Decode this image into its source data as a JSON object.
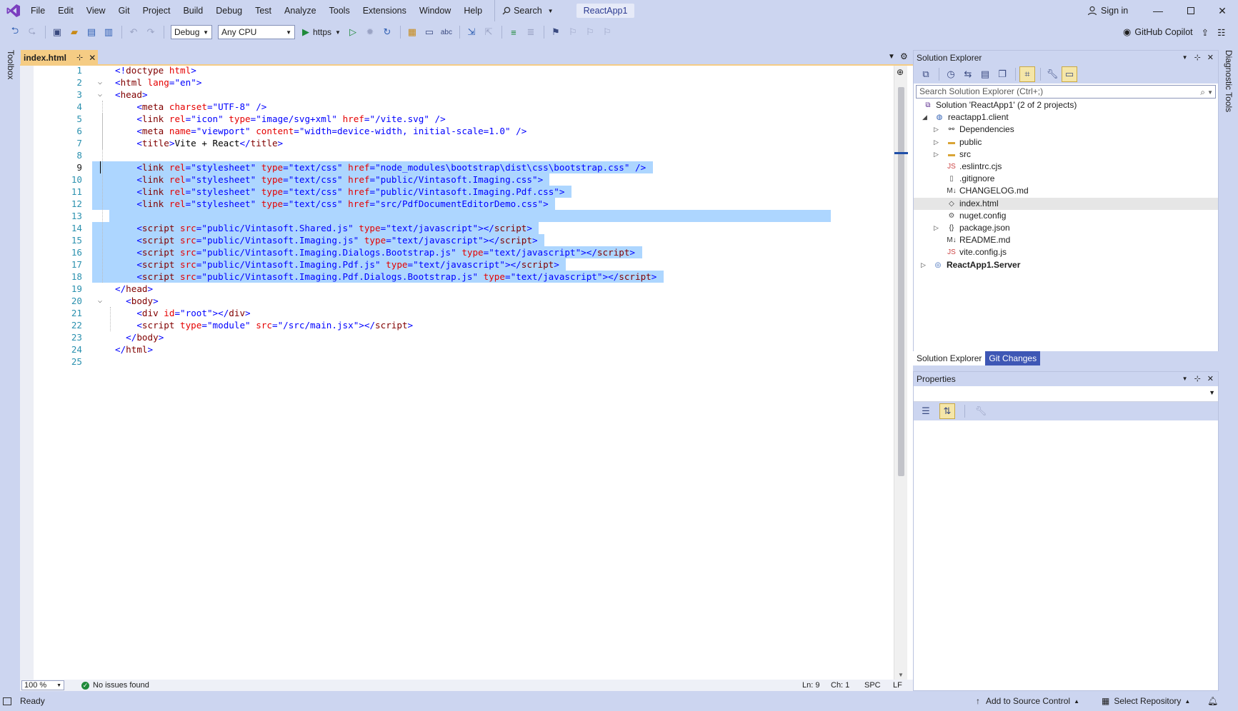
{
  "menubar": {
    "items": [
      "File",
      "Edit",
      "View",
      "Git",
      "Project",
      "Build",
      "Debug",
      "Test",
      "Analyze",
      "Tools",
      "Extensions",
      "Window",
      "Help"
    ],
    "search_label": "Search",
    "solution_name": "ReactApp1",
    "sign_in": "Sign in"
  },
  "toolbar": {
    "configuration": "Debug",
    "platform": "Any CPU",
    "run_target": "https",
    "copilot": "GitHub Copilot"
  },
  "side": {
    "toolbox": "Toolbox",
    "diagnostic_tools": "Diagnostic Tools"
  },
  "editor": {
    "tab_name": "index.html",
    "zoom": "100 %",
    "issues": "No issues found",
    "status": {
      "ln": "Ln: 9",
      "ch": "Ch: 1",
      "enc": "SPC",
      "eol": "LF"
    },
    "current_line": 9,
    "lines": [
      [
        [
          "<!",
          "pun"
        ],
        [
          "doctype",
          "tag"
        ],
        [
          " ",
          "txt"
        ],
        [
          "html",
          "attr"
        ],
        [
          ">",
          "pun"
        ]
      ],
      [
        [
          "<",
          "pun"
        ],
        [
          "html",
          "tag"
        ],
        [
          " ",
          "txt"
        ],
        [
          "lang",
          "attr"
        ],
        [
          "=",
          "pun"
        ],
        [
          "\"en\"",
          "val"
        ],
        [
          ">",
          "pun"
        ]
      ],
      [
        [
          "<",
          "pun"
        ],
        [
          "head",
          "tag"
        ],
        [
          ">",
          "pun"
        ]
      ],
      [
        [
          "    <",
          "pun"
        ],
        [
          "meta",
          "tag"
        ],
        [
          " ",
          "txt"
        ],
        [
          "charset",
          "attr"
        ],
        [
          "=",
          "pun"
        ],
        [
          "\"UTF-8\"",
          "val"
        ],
        [
          " />",
          "pun"
        ]
      ],
      [
        [
          "    <",
          "pun"
        ],
        [
          "link",
          "tag"
        ],
        [
          " ",
          "txt"
        ],
        [
          "rel",
          "attr"
        ],
        [
          "=",
          "pun"
        ],
        [
          "\"icon\"",
          "val"
        ],
        [
          " ",
          "txt"
        ],
        [
          "type",
          "attr"
        ],
        [
          "=",
          "pun"
        ],
        [
          "\"image/svg+xml\"",
          "val"
        ],
        [
          " ",
          "txt"
        ],
        [
          "href",
          "attr"
        ],
        [
          "=",
          "pun"
        ],
        [
          "\"/vite.svg\"",
          "val"
        ],
        [
          " />",
          "pun"
        ]
      ],
      [
        [
          "    <",
          "pun"
        ],
        [
          "meta",
          "tag"
        ],
        [
          " ",
          "txt"
        ],
        [
          "name",
          "attr"
        ],
        [
          "=",
          "pun"
        ],
        [
          "\"viewport\"",
          "val"
        ],
        [
          " ",
          "txt"
        ],
        [
          "content",
          "attr"
        ],
        [
          "=",
          "pun"
        ],
        [
          "\"width=device-width, initial-scale=1.0\"",
          "val"
        ],
        [
          " />",
          "pun"
        ]
      ],
      [
        [
          "    <",
          "pun"
        ],
        [
          "title",
          "tag"
        ],
        [
          ">",
          "pun"
        ],
        [
          "Vite + React",
          "txt"
        ],
        [
          "</",
          "pun"
        ],
        [
          "title",
          "tag"
        ],
        [
          ">",
          "pun"
        ]
      ],
      [],
      [
        [
          "    <",
          "pun"
        ],
        [
          "link",
          "tag"
        ],
        [
          " ",
          "txt"
        ],
        [
          "rel",
          "attr"
        ],
        [
          "=",
          "pun"
        ],
        [
          "\"stylesheet\"",
          "val"
        ],
        [
          " ",
          "txt"
        ],
        [
          "type",
          "attr"
        ],
        [
          "=",
          "pun"
        ],
        [
          "\"text/css\"",
          "val"
        ],
        [
          " ",
          "txt"
        ],
        [
          "href",
          "attr"
        ],
        [
          "=",
          "pun"
        ],
        [
          "\"node_modules\\bootstrap\\dist\\css\\bootstrap.css\"",
          "val"
        ],
        [
          " />",
          "pun"
        ]
      ],
      [
        [
          "    <",
          "pun"
        ],
        [
          "link",
          "tag"
        ],
        [
          " ",
          "txt"
        ],
        [
          "rel",
          "attr"
        ],
        [
          "=",
          "pun"
        ],
        [
          "\"stylesheet\"",
          "val"
        ],
        [
          " ",
          "txt"
        ],
        [
          "type",
          "attr"
        ],
        [
          "=",
          "pun"
        ],
        [
          "\"text/css\"",
          "val"
        ],
        [
          " ",
          "txt"
        ],
        [
          "href",
          "attr"
        ],
        [
          "=",
          "pun"
        ],
        [
          "\"public/Vintasoft.Imaging.css\"",
          "val"
        ],
        [
          ">",
          "pun"
        ]
      ],
      [
        [
          "    <",
          "pun"
        ],
        [
          "link",
          "tag"
        ],
        [
          " ",
          "txt"
        ],
        [
          "rel",
          "attr"
        ],
        [
          "=",
          "pun"
        ],
        [
          "\"stylesheet\"",
          "val"
        ],
        [
          " ",
          "txt"
        ],
        [
          "type",
          "attr"
        ],
        [
          "=",
          "pun"
        ],
        [
          "\"text/css\"",
          "val"
        ],
        [
          " ",
          "txt"
        ],
        [
          "href",
          "attr"
        ],
        [
          "=",
          "pun"
        ],
        [
          "\"public/Vintasoft.Imaging.Pdf.css\"",
          "val"
        ],
        [
          ">",
          "pun"
        ]
      ],
      [
        [
          "    <",
          "pun"
        ],
        [
          "link",
          "tag"
        ],
        [
          " ",
          "txt"
        ],
        [
          "rel",
          "attr"
        ],
        [
          "=",
          "pun"
        ],
        [
          "\"stylesheet\"",
          "val"
        ],
        [
          " ",
          "txt"
        ],
        [
          "type",
          "attr"
        ],
        [
          "=",
          "pun"
        ],
        [
          "\"text/css\"",
          "val"
        ],
        [
          " ",
          "txt"
        ],
        [
          "href",
          "attr"
        ],
        [
          "=",
          "pun"
        ],
        [
          "\"src/PdfDocumentEditorDemo.css\"",
          "val"
        ],
        [
          ">",
          "pun"
        ]
      ],
      [],
      [
        [
          "    <",
          "pun"
        ],
        [
          "script",
          "tag"
        ],
        [
          " ",
          "txt"
        ],
        [
          "src",
          "attr"
        ],
        [
          "=",
          "pun"
        ],
        [
          "\"public/Vintasoft.Shared.js\"",
          "val"
        ],
        [
          " ",
          "txt"
        ],
        [
          "type",
          "attr"
        ],
        [
          "=",
          "pun"
        ],
        [
          "\"text/javascript\"",
          "val"
        ],
        [
          "></",
          "pun"
        ],
        [
          "script",
          "tag"
        ],
        [
          ">",
          "pun"
        ]
      ],
      [
        [
          "    <",
          "pun"
        ],
        [
          "script",
          "tag"
        ],
        [
          " ",
          "txt"
        ],
        [
          "src",
          "attr"
        ],
        [
          "=",
          "pun"
        ],
        [
          "\"public/Vintasoft.Imaging.js\"",
          "val"
        ],
        [
          " ",
          "txt"
        ],
        [
          "type",
          "attr"
        ],
        [
          "=",
          "pun"
        ],
        [
          "\"text/javascript\"",
          "val"
        ],
        [
          "></",
          "pun"
        ],
        [
          "script",
          "tag"
        ],
        [
          ">",
          "pun"
        ]
      ],
      [
        [
          "    <",
          "pun"
        ],
        [
          "script",
          "tag"
        ],
        [
          " ",
          "txt"
        ],
        [
          "src",
          "attr"
        ],
        [
          "=",
          "pun"
        ],
        [
          "\"public/Vintasoft.Imaging.Dialogs.Bootstrap.js\"",
          "val"
        ],
        [
          " ",
          "txt"
        ],
        [
          "type",
          "attr"
        ],
        [
          "=",
          "pun"
        ],
        [
          "\"text/javascript\"",
          "val"
        ],
        [
          "></",
          "pun"
        ],
        [
          "script",
          "tag"
        ],
        [
          ">",
          "pun"
        ]
      ],
      [
        [
          "    <",
          "pun"
        ],
        [
          "script",
          "tag"
        ],
        [
          " ",
          "txt"
        ],
        [
          "src",
          "attr"
        ],
        [
          "=",
          "pun"
        ],
        [
          "\"public/Vintasoft.Imaging.Pdf.js\"",
          "val"
        ],
        [
          " ",
          "txt"
        ],
        [
          "type",
          "attr"
        ],
        [
          "=",
          "pun"
        ],
        [
          "\"text/javascript\"",
          "val"
        ],
        [
          "></",
          "pun"
        ],
        [
          "script",
          "tag"
        ],
        [
          ">",
          "pun"
        ]
      ],
      [
        [
          "    <",
          "pun"
        ],
        [
          "script",
          "tag"
        ],
        [
          " ",
          "txt"
        ],
        [
          "src",
          "attr"
        ],
        [
          "=",
          "pun"
        ],
        [
          "\"public/Vintasoft.Imaging.Pdf.Dialogs.Bootstrap.js\"",
          "val"
        ],
        [
          " ",
          "txt"
        ],
        [
          "type",
          "attr"
        ],
        [
          "=",
          "pun"
        ],
        [
          "\"text/javascript\"",
          "val"
        ],
        [
          "></",
          "pun"
        ],
        [
          "script",
          "tag"
        ],
        [
          ">",
          "pun"
        ]
      ],
      [
        [
          "</",
          "pun"
        ],
        [
          "head",
          "tag"
        ],
        [
          ">",
          "pun"
        ]
      ],
      [
        [
          "  <",
          "pun"
        ],
        [
          "body",
          "tag"
        ],
        [
          ">",
          "pun"
        ]
      ],
      [
        [
          "    <",
          "pun"
        ],
        [
          "div",
          "tag"
        ],
        [
          " ",
          "txt"
        ],
        [
          "id",
          "attr"
        ],
        [
          "=",
          "pun"
        ],
        [
          "\"root\"",
          "val"
        ],
        [
          "></",
          "pun"
        ],
        [
          "div",
          "tag"
        ],
        [
          ">",
          "pun"
        ]
      ],
      [
        [
          "    <",
          "pun"
        ],
        [
          "script",
          "tag"
        ],
        [
          " ",
          "txt"
        ],
        [
          "type",
          "attr"
        ],
        [
          "=",
          "pun"
        ],
        [
          "\"module\"",
          "val"
        ],
        [
          " ",
          "txt"
        ],
        [
          "src",
          "attr"
        ],
        [
          "=",
          "pun"
        ],
        [
          "\"/src/main.jsx\"",
          "val"
        ],
        [
          "></",
          "pun"
        ],
        [
          "script",
          "tag"
        ],
        [
          ">",
          "pun"
        ]
      ],
      [
        [
          "  </",
          "pun"
        ],
        [
          "body",
          "tag"
        ],
        [
          ">",
          "pun"
        ]
      ],
      [
        [
          "</",
          "pun"
        ],
        [
          "html",
          "tag"
        ],
        [
          ">",
          "pun"
        ]
      ],
      []
    ],
    "folded_lines": [
      2,
      3,
      20
    ]
  },
  "solution_explorer": {
    "title": "Solution Explorer",
    "search_placeholder": "Search Solution Explorer (Ctrl+;)",
    "tabs": [
      "Solution Explorer",
      "Git Changes"
    ],
    "tree": [
      {
        "label": "Solution 'ReactApp1' (2 of 2 projects)",
        "icon": "solution-icon",
        "depth": 0,
        "twisty": ""
      },
      {
        "label": "reactapp1.client",
        "icon": "project-icon",
        "depth": 1,
        "twisty": "open"
      },
      {
        "label": "Dependencies",
        "icon": "dependencies-icon",
        "depth": 2,
        "twisty": "closed"
      },
      {
        "label": "public",
        "icon": "folder-icon",
        "depth": 2,
        "twisty": "closed"
      },
      {
        "label": "src",
        "icon": "folder-icon",
        "depth": 2,
        "twisty": "closed"
      },
      {
        "label": ".eslintrc.cjs",
        "icon": "js-file-icon",
        "depth": 2,
        "twisty": ""
      },
      {
        "label": ".gitignore",
        "icon": "file-icon",
        "depth": 2,
        "twisty": ""
      },
      {
        "label": "CHANGELOG.md",
        "icon": "markdown-file-icon",
        "depth": 2,
        "twisty": ""
      },
      {
        "label": "index.html",
        "icon": "html-file-icon",
        "depth": 2,
        "twisty": "",
        "selected": true
      },
      {
        "label": "nuget.config",
        "icon": "config-file-icon",
        "depth": 2,
        "twisty": ""
      },
      {
        "label": "package.json",
        "icon": "json-file-icon",
        "depth": 2,
        "twisty": "closed"
      },
      {
        "label": "README.md",
        "icon": "markdown-file-icon",
        "depth": 2,
        "twisty": ""
      },
      {
        "label": "vite.config.js",
        "icon": "js-file-icon",
        "depth": 2,
        "twisty": ""
      },
      {
        "label": "ReactApp1.Server",
        "icon": "web-project-icon",
        "depth": 0,
        "twisty": "closed",
        "bold": true
      }
    ]
  },
  "properties": {
    "title": "Properties"
  },
  "statusbar": {
    "ready": "Ready",
    "add_source_control": "Add to Source Control",
    "select_repository": "Select Repository"
  },
  "colors": {
    "chrome": "#ccd5f0",
    "tab_active": "#f5cc84",
    "selection": "#add6ff",
    "accent": "#3e57b5"
  }
}
